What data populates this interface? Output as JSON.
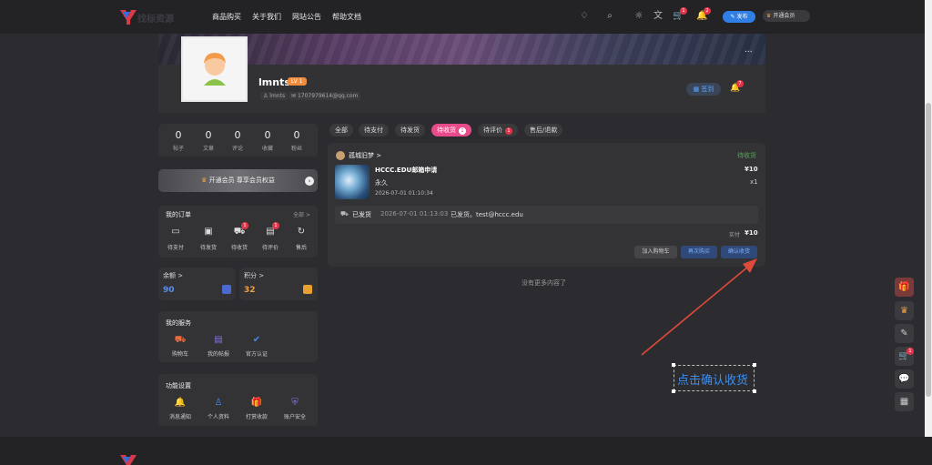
{
  "topbar": {
    "logo_text": "找标资源",
    "nav": [
      "商品购买",
      "关于我们",
      "网站公告",
      "帮助文档"
    ],
    "cart_badge": "1",
    "bell_badge": "2",
    "publish_label": "发布",
    "vip_label": "开通会员"
  },
  "profile": {
    "name": "lmnts",
    "level": "LV 1",
    "username": "lmnts",
    "email": "1707979614@qq.com",
    "checkin_label": "签到",
    "bell_badge": "7",
    "more": "..."
  },
  "stats": [
    {
      "value": "0",
      "label": "帖子"
    },
    {
      "value": "0",
      "label": "文章"
    },
    {
      "value": "0",
      "label": "评论"
    },
    {
      "value": "0",
      "label": "收藏"
    },
    {
      "value": "0",
      "label": "粉丝"
    }
  ],
  "vip_banner": "开通会员 尊享会员权益",
  "orders": {
    "title": "我的订单",
    "all": "全部 >",
    "items": [
      {
        "label": "待支付",
        "badge": ""
      },
      {
        "label": "待发货",
        "badge": ""
      },
      {
        "label": "待收货",
        "badge": "1"
      },
      {
        "label": "待评价",
        "badge": "1"
      },
      {
        "label": "售后",
        "badge": ""
      }
    ]
  },
  "balance": {
    "label": "余额 >",
    "value": "90"
  },
  "points": {
    "label": "积分 >",
    "value": "32"
  },
  "services": {
    "title": "我的服务",
    "items": [
      "购物车",
      "我的帖报",
      "官方认证"
    ]
  },
  "settings": {
    "title": "功能设置",
    "items": [
      "消息通知",
      "个人资料",
      "打赏收款",
      "账户安全"
    ]
  },
  "tabs": [
    {
      "label": "全部",
      "badge": ""
    },
    {
      "label": "待支付",
      "badge": ""
    },
    {
      "label": "待发货",
      "badge": ""
    },
    {
      "label": "待收货",
      "badge": "1"
    },
    {
      "label": "待评价",
      "badge": "1"
    },
    {
      "label": "售后/退款",
      "badge": ""
    }
  ],
  "order": {
    "seller": "孤城旧梦 >",
    "status": "待收货",
    "product": "HCCC.EDU邮箱申请",
    "spec": "永久",
    "date": "2026-07-01 01:10:34",
    "price": "¥10",
    "qty": "x1",
    "ship_label": "已发货",
    "ship_time": "2026-07-01 01:13:03",
    "ship_info": "已发货。test@hccc.edu",
    "paid_label": "实付",
    "paid_value": "¥10",
    "btn_cart": "加入购物车",
    "btn_rebuy": "再次购买",
    "btn_confirm": "确认收货"
  },
  "no_more": "没有更多内容了",
  "annotation": "点击确认收货",
  "side": {
    "cart_badge": "1"
  },
  "colors": {
    "accent": "#e84b8a",
    "blue": "#2f7fe6",
    "vip": "#f0a040"
  }
}
